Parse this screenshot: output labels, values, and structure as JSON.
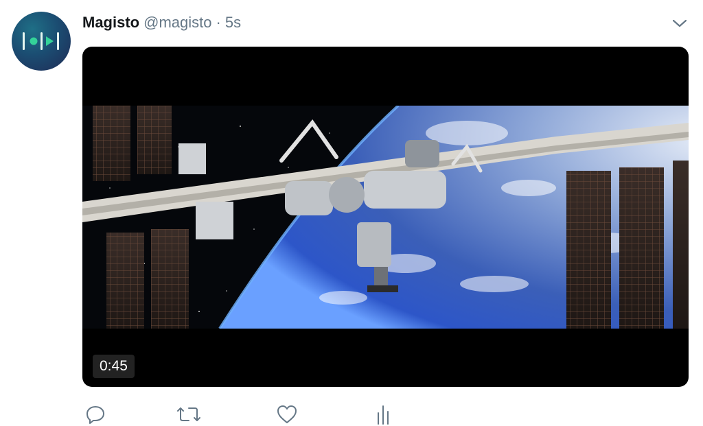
{
  "tweet": {
    "author_name": "Magisto",
    "handle": "@magisto",
    "separator": "·",
    "time": "5s",
    "avatar_icon": "magisto-logo-icon",
    "menu_icon": "chevron-down-icon"
  },
  "media": {
    "duration": "0:45",
    "subject": "space-station-over-earth"
  },
  "actions": [
    {
      "icon": "reply-icon"
    },
    {
      "icon": "retweet-icon"
    },
    {
      "icon": "like-icon"
    },
    {
      "icon": "analytics-icon"
    }
  ],
  "colors": {
    "name": "#14171a",
    "secondary": "#657786",
    "action_icon": "#657786",
    "avatar_accent": "#34d399"
  }
}
